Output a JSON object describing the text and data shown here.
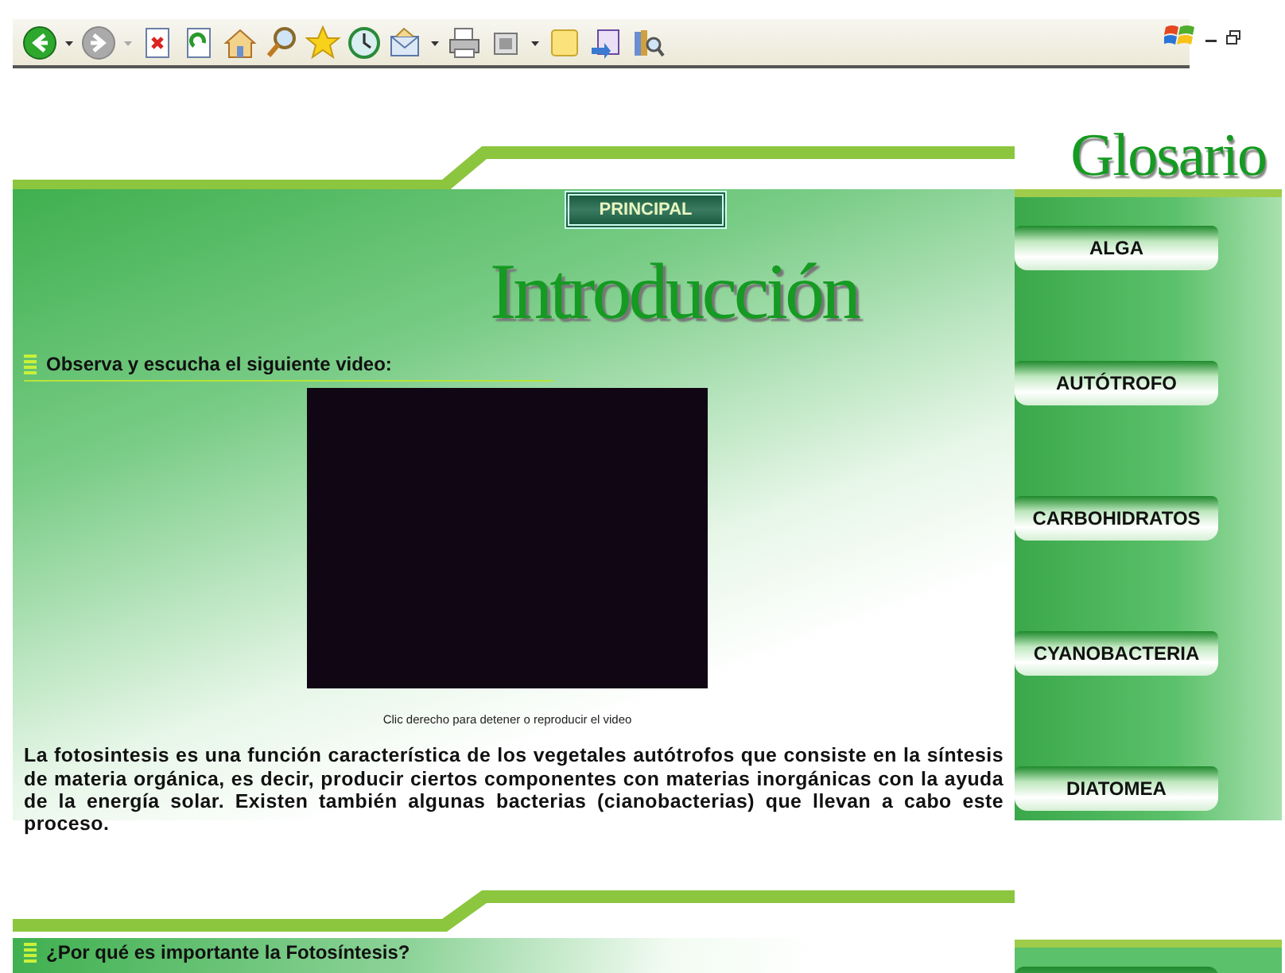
{
  "navigation": {
    "back": {
      "disabled": false
    },
    "forward": {
      "disabled": true
    }
  },
  "page": {
    "principal_button": "PRINCIPAL",
    "title": "Introducción",
    "sections": [
      {
        "heading": "Observa y escucha el siguiente video:",
        "video_caption": "Clic derecho para detener o reproducir el video",
        "paragraph": "La fotosintesis es una función característica de los vegetales autótrofos que consiste en la síntesis de materia orgánica, es decir, producir ciertos componentes con materias inorgánicas con la ayuda de la energía solar. Existen también algunas bacterias (cianobacterias) que llevan a cabo este proceso."
      },
      {
        "heading": "¿Por qué es importante la Fotosíntesis?"
      }
    ]
  },
  "glossary": {
    "title": "Glosario",
    "items": [
      "ALGA",
      "AUTÓTROFO",
      "CARBOHIDRATOS",
      "CYANOBACTERIA",
      "DIATOMEA"
    ]
  }
}
